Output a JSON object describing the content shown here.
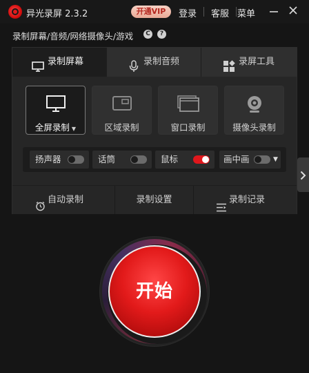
{
  "window": {
    "app_title": "异光录屏 2.3.2",
    "vip_label": "开通VIP",
    "login": "登录",
    "service": "客服",
    "menu": "菜单",
    "minimize": "—",
    "close": "✕"
  },
  "subtitle": {
    "text": "录制屏幕/音频/网络摄像头/游戏",
    "c_icon": "C",
    "help_icon": "?"
  },
  "tabs": [
    {
      "label": "录制屏幕",
      "icon": "monitor-icon",
      "active": true
    },
    {
      "label": "录制音频",
      "icon": "microphone-icon",
      "active": false
    },
    {
      "label": "录屏工具",
      "icon": "tools-grid-icon",
      "active": false
    }
  ],
  "modes": [
    {
      "label": "全屏录制",
      "active": true
    },
    {
      "label": "区域录制",
      "active": false
    },
    {
      "label": "窗口录制",
      "active": false
    },
    {
      "label": "摄像头录制",
      "active": false
    }
  ],
  "toggles": [
    {
      "label": "扬声器",
      "on": false
    },
    {
      "label": "话筒",
      "on": false
    },
    {
      "label": "鼠标",
      "on": true
    },
    {
      "label": "画中画",
      "on": false
    }
  ],
  "bottom": {
    "auto_record": "自动录制",
    "settings": "录制设置",
    "history": "录制记录"
  },
  "start_label": "开始",
  "colors": {
    "accent_red": "#e21a1a",
    "background": "#151515",
    "panel": "#262626"
  }
}
